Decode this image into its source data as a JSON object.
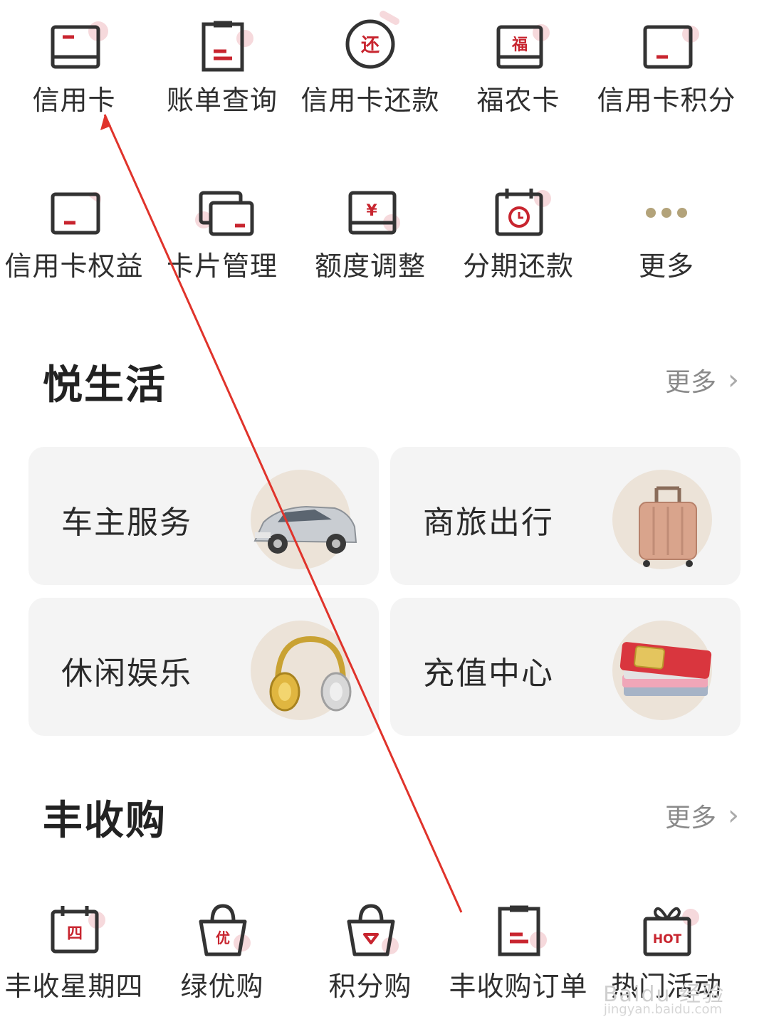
{
  "accent_color": "#c8252f",
  "services_row1": [
    {
      "label": "信用卡",
      "icon": "credit-card-icon"
    },
    {
      "label": "账单查询",
      "icon": "bill-icon"
    },
    {
      "label": "信用卡还款",
      "icon": "repay-icon",
      "glyph": "还"
    },
    {
      "label": "福农卡",
      "icon": "fu-card-icon",
      "glyph": "福"
    },
    {
      "label": "信用卡积分",
      "icon": "points-card-icon"
    }
  ],
  "services_row2": [
    {
      "label": "信用卡权益",
      "icon": "benefits-card-icon"
    },
    {
      "label": "卡片管理",
      "icon": "cards-manage-icon"
    },
    {
      "label": "额度调整",
      "icon": "limit-adjust-icon",
      "glyph": "¥"
    },
    {
      "label": "分期还款",
      "icon": "installment-calendar-icon"
    },
    {
      "label": "更多",
      "icon": "more-dots-icon"
    }
  ],
  "life": {
    "title": "悦生活",
    "more": "更多",
    "cards": [
      {
        "title": "车主服务",
        "image": "car-image"
      },
      {
        "title": "商旅出行",
        "image": "luggage-image"
      },
      {
        "title": "休闲娱乐",
        "image": "headphones-image"
      },
      {
        "title": "充值中心",
        "image": "sim-card-image"
      }
    ]
  },
  "harvest": {
    "title": "丰收购",
    "more": "更多",
    "items": [
      {
        "label": "丰收星期四",
        "icon": "thursday-calendar-icon",
        "glyph": "四"
      },
      {
        "label": "绿优购",
        "icon": "green-bag-icon",
        "glyph": "优"
      },
      {
        "label": "积分购",
        "icon": "points-bag-icon"
      },
      {
        "label": "丰收购订单",
        "icon": "order-icon"
      },
      {
        "label": "热门活动",
        "icon": "hot-gift-icon",
        "glyph": "HOT"
      }
    ]
  },
  "watermark": {
    "text": "Baidu 经验",
    "sub": "jingyan.baidu.com"
  }
}
